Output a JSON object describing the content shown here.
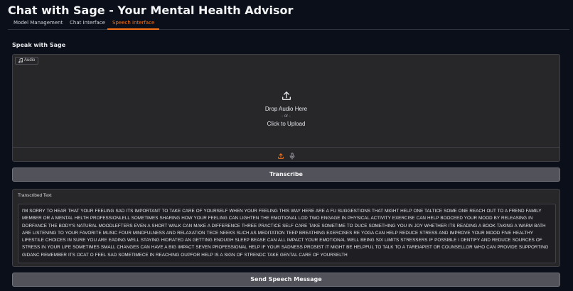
{
  "app": {
    "title": "Chat with Sage - Your Mental Health Advisor"
  },
  "tabs": [
    {
      "label": "Model Management"
    },
    {
      "label": "Chat Interface"
    },
    {
      "label": "Speech Interface",
      "active": true
    }
  ],
  "speech": {
    "section_title": "Speak with Sage",
    "audio_badge": "Audio",
    "drop_text": "Drop Audio Here",
    "or_text": "- or -",
    "click_text": "Click to Upload",
    "transcribe_label": "Transcribe",
    "transcribed_label": "Transcribed Text",
    "transcribed_text": "I'M SORRY TO HEAR THAT YOUR FEELING SAD ITS IMPORTANT TO TAKE CARE OF YOURSELF WHEN YOUR FEELING THIS WAY HERE ARE A FU SUGGESTIONS THAT MIGHT HELP ONE TALTICE SOME ONE REACH OUT TO A FREND FAMILY MEMBER OR A MENTAL HELTH PROFESSIONLELL SOMETIMES SHARING HOW YOUR FEELING CAN LIGHTEN THE EMOTIONAL LOD TWO ENGAGE IN PHYSICAL ACTIVITY EXERCISE CAN HELP BOOCEED YOUR MOOD BY RELEASING IN DORFANCE THE BODY'S NATURAL MOODLEFTERS EVEN A SHORT WALK CAN MAKE A DIFFERENCE THREE PRACTICE SELF CARE TAKE SOMETIME TO DUCE SOMETHING YOU IN JOY WHETHER ITS READING A BOOK TAKING A WARM BATH ARE LISTENING TO YOUR FAVORITE MUSIC FOUR MINDFULNESS AND RELAXATION TECE NEEKS SUCH AS MEDITATION TEEP BREATHING EXERCISES RE YOGA CAN HELP REDUCE STRESS AND IMPROVE YOUR MOOD FIVE HEALTHY LIFESTILE CHOICES IN SURE YOU ARE EADING WELL STAYING HIDRATED AN GETTING ENOUGH SLEEP BEASE CAN ALL IMPACT YOUR EMOTIONAL WELL BEING SIX LIMITS STRESSERS IF POSSIBLE I DENTIFY AND REDUCE SOURCES OF STRESS IN YOUR LIFE SOMETIMES SMALL CHANGES CAN HAVE A BIG IMPACT SEVEN PROFESSIONAL HELP IF YOUR SADNESS PROSIST IT MIGHT BE HELPFUL TO TALK TO A TAREIAPIST OR COUNSELLOR WHO CAN PROVIDE SUPPORTING GIDANC REMEMBER ITS OCAT O FEEL SAD SOMETIMECE IN REACHING OUPFOR HELP IS A SIGN OF STRENDC TAKE GENTAL CARE OF YOURSELTH",
    "send_label": "Send Speech Message"
  },
  "icons": {
    "music_note": "music-note-icon",
    "upload": "upload-icon",
    "microphone": "microphone-icon"
  },
  "colors": {
    "accent": "#f97316",
    "background": "#0b0f19",
    "panel": "#27272a",
    "button": "#52525b"
  }
}
